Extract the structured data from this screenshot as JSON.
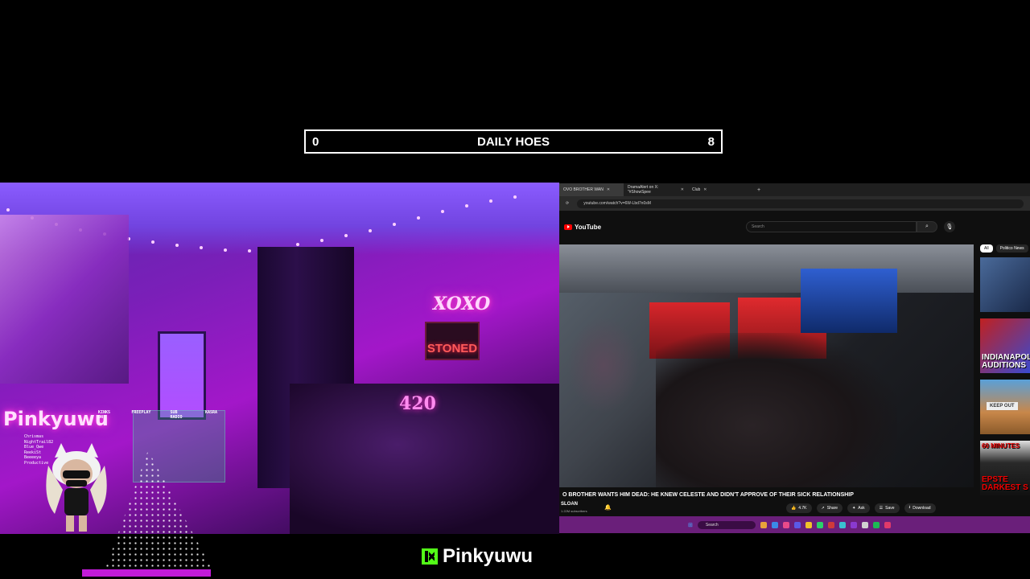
{
  "counter": {
    "left_value": "0",
    "title": "DAILY HOES",
    "right_value": "8"
  },
  "cam": {
    "brand_neon": "Pinkyuwu",
    "neon_xoxo": "XOXO",
    "neon_stoned": "STONED",
    "neon_420": "420",
    "stats": {
      "headers": [
        "KINKS ON",
        "FREEPLAY",
        "SUB RADIO",
        "KASRA"
      ],
      "leaders": [
        "Chrismas",
        "NightTrail82",
        "Blue_Qwe",
        "ReekiSt",
        "Beeeeya",
        "Productive"
      ]
    }
  },
  "browser": {
    "tabs": [
      {
        "label": "OVO BROTHER WAN",
        "active": true
      },
      {
        "label": "DramaAlert on X: \"#ShowSpee",
        "active": false
      },
      {
        "label": "Club",
        "active": false
      }
    ],
    "new_tab": "+",
    "url": "youtube.com/watch?v=6W-Lbd7n0sM",
    "youtube": {
      "logo_text": "YouTube",
      "search_placeholder": "Search",
      "chips": [
        "All",
        "Politico News"
      ],
      "video_title": "O BROTHER WANTS HIM DEAD: HE KNEW CELESTE AND DIDN'T APPROVE OF THEIR SICK RELATIONSHIP",
      "channel": "SLOAN",
      "subscribers": "1.22M subscribers",
      "actions": [
        {
          "icon": "like-icon",
          "label": "4.7K"
        },
        {
          "icon": "share-icon",
          "label": "Share"
        },
        {
          "icon": "ask-icon",
          "label": "Ask"
        },
        {
          "icon": "save-icon",
          "label": "Save"
        },
        {
          "icon": "download-icon",
          "label": "Download"
        }
      ],
      "recommendations": [
        {
          "text": ""
        },
        {
          "text": "INDIANAPOLIS AUDITIONS"
        },
        {
          "text": "KEEP OUT"
        },
        {
          "text": "EPSTE DARKEST S"
        }
      ],
      "rec4_badge": "60 MINUTES"
    },
    "taskbar": {
      "search_label": "Search"
    }
  },
  "footer": {
    "brand": "Pinkyuwu"
  },
  "colors": {
    "accent_pink": "#c21bd8",
    "kick_green": "#53fc18",
    "youtube_red": "#ff0000"
  }
}
